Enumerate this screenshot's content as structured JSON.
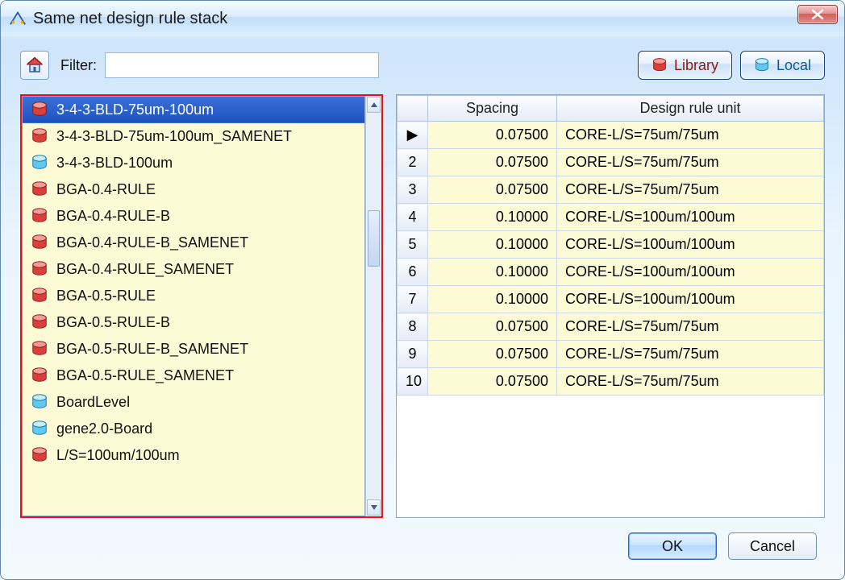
{
  "window": {
    "title": "Same net design rule stack"
  },
  "toolbar": {
    "filter_label": "Filter:",
    "filter_value": "",
    "library_label": "Library",
    "local_label": "Local"
  },
  "list": {
    "items": [
      {
        "label": "3-4-3-BLD-75um-100um",
        "icon": "red",
        "selected": true
      },
      {
        "label": "3-4-3-BLD-75um-100um_SAMENET",
        "icon": "red",
        "selected": false
      },
      {
        "label": "3-4-3-BLD-100um",
        "icon": "blue",
        "selected": false
      },
      {
        "label": "BGA-0.4-RULE",
        "icon": "red",
        "selected": false
      },
      {
        "label": "BGA-0.4-RULE-B",
        "icon": "red",
        "selected": false
      },
      {
        "label": "BGA-0.4-RULE-B_SAMENET",
        "icon": "red",
        "selected": false
      },
      {
        "label": "BGA-0.4-RULE_SAMENET",
        "icon": "red",
        "selected": false
      },
      {
        "label": "BGA-0.5-RULE",
        "icon": "red",
        "selected": false
      },
      {
        "label": "BGA-0.5-RULE-B",
        "icon": "red",
        "selected": false
      },
      {
        "label": "BGA-0.5-RULE-B_SAMENET",
        "icon": "red",
        "selected": false
      },
      {
        "label": "BGA-0.5-RULE_SAMENET",
        "icon": "red",
        "selected": false
      },
      {
        "label": "BoardLevel",
        "icon": "blue",
        "selected": false
      },
      {
        "label": "gene2.0-Board",
        "icon": "blue",
        "selected": false
      },
      {
        "label": "L/S=100um/100um",
        "icon": "red",
        "selected": false
      }
    ]
  },
  "table": {
    "columns": {
      "spacing": "Spacing",
      "dru": "Design rule unit"
    },
    "rows": [
      {
        "n": "▶",
        "spacing": "0.07500",
        "dru": "CORE-L/S=75um/75um"
      },
      {
        "n": "2",
        "spacing": "0.07500",
        "dru": "CORE-L/S=75um/75um"
      },
      {
        "n": "3",
        "spacing": "0.07500",
        "dru": "CORE-L/S=75um/75um"
      },
      {
        "n": "4",
        "spacing": "0.10000",
        "dru": "CORE-L/S=100um/100um"
      },
      {
        "n": "5",
        "spacing": "0.10000",
        "dru": "CORE-L/S=100um/100um"
      },
      {
        "n": "6",
        "spacing": "0.10000",
        "dru": "CORE-L/S=100um/100um"
      },
      {
        "n": "7",
        "spacing": "0.10000",
        "dru": "CORE-L/S=100um/100um"
      },
      {
        "n": "8",
        "spacing": "0.07500",
        "dru": "CORE-L/S=75um/75um"
      },
      {
        "n": "9",
        "spacing": "0.07500",
        "dru": "CORE-L/S=75um/75um"
      },
      {
        "n": "10",
        "spacing": "0.07500",
        "dru": "CORE-L/S=75um/75um"
      }
    ]
  },
  "footer": {
    "ok": "OK",
    "cancel": "Cancel"
  },
  "colors": {
    "red_cyl": "#d33",
    "blue_cyl": "#57c3f0"
  }
}
